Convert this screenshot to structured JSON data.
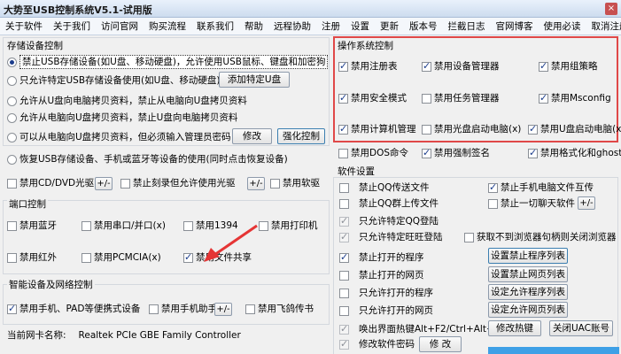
{
  "window": {
    "title": "大势至USB控制系统V5.1-试用版",
    "close": "×"
  },
  "menu": [
    "关于软件",
    "关于我们",
    "访问官网",
    "购买流程",
    "联系我们",
    "帮助",
    "远程协助",
    "注册",
    "设置",
    "更新",
    "版本号",
    "拦截日志",
    "官网博客",
    "使用必读",
    "取消注册"
  ],
  "storage": {
    "title": "存储设备控制",
    "opt1": "禁止USB存储设备(如U盘、移动硬盘)，允许使用USB鼠标、键盘和加密狗",
    "opt2": "只允许特定USB存储设备使用(如U盘、移动硬盘)",
    "opt2_btn": "添加特定U盘",
    "opt3": "允许从U盘向电脑拷贝资料，禁止从电脑向U盘拷贝资料",
    "opt4": "允许从电脑向U盘拷贝资料，禁止U盘向电脑拷贝资料",
    "opt5": "可以从电脑向U盘拷贝资料，但必须输入管理员密码",
    "opt5_btn1": "修改",
    "opt5_btn2": "强化控制",
    "opt6": "恢复USB存储设备、手机或蓝牙等设备的使用(同时点击恢复设备)",
    "cb_cd": "禁用CD/DVD光驱",
    "cb_burn": "禁止刻录但允许使用光驱",
    "cb_floppy": "禁用软驱",
    "plusminus": "+/-"
  },
  "port": {
    "title": "端口控制",
    "bluetooth": "禁用蓝牙",
    "serial": "禁用串口/并口(x)",
    "p1394": "禁用1394",
    "printer": "禁用打印机",
    "infrared": "禁用红外",
    "pcmcia": "禁用PCMCIA(x)",
    "share": "禁用文件共享"
  },
  "smart": {
    "title": "智能设备及网络控制",
    "phone": "禁用手机、PAD等便携式设备",
    "helper": "禁用手机助手",
    "feige": "禁用飞鸽传书",
    "plusminus": "+/-"
  },
  "nic": {
    "label": "当前网卡名称:",
    "value": "Realtek PCIe GBE Family Controller"
  },
  "os": {
    "title": "操作系统控制",
    "registry": "禁用注册表",
    "devmgr": "禁用设备管理器",
    "gpedit": "禁用组策略",
    "safemode": "禁用安全模式",
    "taskmgr": "禁用任务管理器",
    "msconfig": "禁用Msconfig",
    "compmgmt": "禁用计算机管理",
    "cdboot": "禁用光盘启动电脑(x)",
    "usbboot": "禁用U盘启动电脑(x)",
    "dos": "禁用DOS命令",
    "sign": "禁用强制签名",
    "ghost": "禁用格式化和ghost"
  },
  "software": {
    "title": "软件设置",
    "qq_send": "禁止QQ传送文件",
    "phone_copy": "禁止手机电脑文件互传",
    "qq_group": "禁止QQ群上传文件",
    "block_all": "禁止一切聊天软件",
    "plusminus": "+/-",
    "qq_allow": "只允许特定QQ登陆",
    "wangwang": "只允许特定旺旺登陆",
    "browser_sub": "获取不到浏览器句柄则关闭浏览器",
    "block_prog": "禁止打开的程序",
    "block_prog_btn": "设置禁止程序列表",
    "block_web": "禁止打开的网页",
    "block_web_btn": "设置禁止网页列表",
    "allow_prog": "只允许打开的程序",
    "allow_prog_btn": "设定允许程序列表",
    "allow_web": "只允许打开的网页",
    "allow_web_btn": "设定允许网页列表",
    "hotkey": "唤出界面热键Alt+F2/Ctrl+Alt+2",
    "hotkey_btn": "修改热键",
    "uac_btn": "关闭UAC账号",
    "pwd": "修改软件密码",
    "pwd_btn": "修 改"
  }
}
